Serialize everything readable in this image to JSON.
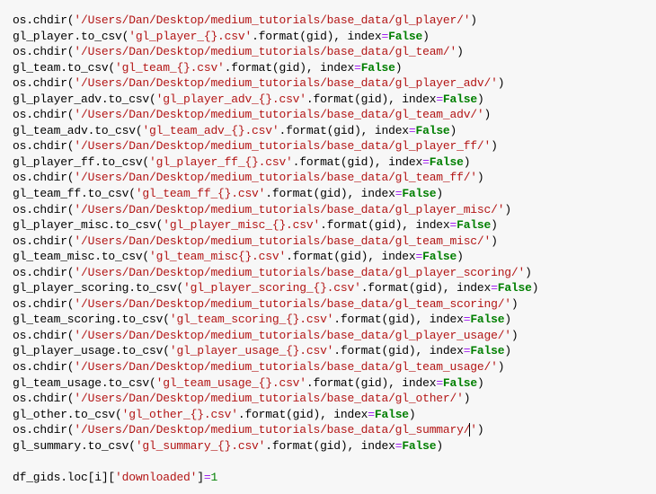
{
  "code_lines": [
    [
      {
        "t": "os.chdir(",
        "cls": "c"
      },
      {
        "t": "'/Users/Dan/Desktop/medium_tutorials/base_data/gl_player/'",
        "cls": "s"
      },
      {
        "t": ")",
        "cls": "c"
      }
    ],
    [
      {
        "t": "gl_player.to_csv(",
        "cls": "c"
      },
      {
        "t": "'gl_player_{}.csv'",
        "cls": "s"
      },
      {
        "t": ".format(gid), index",
        "cls": "c"
      },
      {
        "t": "=",
        "cls": "op"
      },
      {
        "t": "False",
        "cls": "k"
      },
      {
        "t": ")",
        "cls": "c"
      }
    ],
    [
      {
        "t": "os.chdir(",
        "cls": "c"
      },
      {
        "t": "'/Users/Dan/Desktop/medium_tutorials/base_data/gl_team/'",
        "cls": "s"
      },
      {
        "t": ")",
        "cls": "c"
      }
    ],
    [
      {
        "t": "gl_team.to_csv(",
        "cls": "c"
      },
      {
        "t": "'gl_team_{}.csv'",
        "cls": "s"
      },
      {
        "t": ".format(gid), index",
        "cls": "c"
      },
      {
        "t": "=",
        "cls": "op"
      },
      {
        "t": "False",
        "cls": "k"
      },
      {
        "t": ")",
        "cls": "c"
      }
    ],
    [
      {
        "t": "os.chdir(",
        "cls": "c"
      },
      {
        "t": "'/Users/Dan/Desktop/medium_tutorials/base_data/gl_player_adv/'",
        "cls": "s"
      },
      {
        "t": ")",
        "cls": "c"
      }
    ],
    [
      {
        "t": "gl_player_adv.to_csv(",
        "cls": "c"
      },
      {
        "t": "'gl_player_adv_{}.csv'",
        "cls": "s"
      },
      {
        "t": ".format(gid), index",
        "cls": "c"
      },
      {
        "t": "=",
        "cls": "op"
      },
      {
        "t": "False",
        "cls": "k"
      },
      {
        "t": ")",
        "cls": "c"
      }
    ],
    [
      {
        "t": "os.chdir(",
        "cls": "c"
      },
      {
        "t": "'/Users/Dan/Desktop/medium_tutorials/base_data/gl_team_adv/'",
        "cls": "s"
      },
      {
        "t": ")",
        "cls": "c"
      }
    ],
    [
      {
        "t": "gl_team_adv.to_csv(",
        "cls": "c"
      },
      {
        "t": "'gl_team_adv_{}.csv'",
        "cls": "s"
      },
      {
        "t": ".format(gid), index",
        "cls": "c"
      },
      {
        "t": "=",
        "cls": "op"
      },
      {
        "t": "False",
        "cls": "k"
      },
      {
        "t": ")",
        "cls": "c"
      }
    ],
    [
      {
        "t": "os.chdir(",
        "cls": "c"
      },
      {
        "t": "'/Users/Dan/Desktop/medium_tutorials/base_data/gl_player_ff/'",
        "cls": "s"
      },
      {
        "t": ")",
        "cls": "c"
      }
    ],
    [
      {
        "t": "gl_player_ff.to_csv(",
        "cls": "c"
      },
      {
        "t": "'gl_player_ff_{}.csv'",
        "cls": "s"
      },
      {
        "t": ".format(gid), index",
        "cls": "c"
      },
      {
        "t": "=",
        "cls": "op"
      },
      {
        "t": "False",
        "cls": "k"
      },
      {
        "t": ")",
        "cls": "c"
      }
    ],
    [
      {
        "t": "os.chdir(",
        "cls": "c"
      },
      {
        "t": "'/Users/Dan/Desktop/medium_tutorials/base_data/gl_team_ff/'",
        "cls": "s"
      },
      {
        "t": ")",
        "cls": "c"
      }
    ],
    [
      {
        "t": "gl_team_ff.to_csv(",
        "cls": "c"
      },
      {
        "t": "'gl_team_ff_{}.csv'",
        "cls": "s"
      },
      {
        "t": ".format(gid), index",
        "cls": "c"
      },
      {
        "t": "=",
        "cls": "op"
      },
      {
        "t": "False",
        "cls": "k"
      },
      {
        "t": ")",
        "cls": "c"
      }
    ],
    [
      {
        "t": "os.chdir(",
        "cls": "c"
      },
      {
        "t": "'/Users/Dan/Desktop/medium_tutorials/base_data/gl_player_misc/'",
        "cls": "s"
      },
      {
        "t": ")",
        "cls": "c"
      }
    ],
    [
      {
        "t": "gl_player_misc.to_csv(",
        "cls": "c"
      },
      {
        "t": "'gl_player_misc_{}.csv'",
        "cls": "s"
      },
      {
        "t": ".format(gid), index",
        "cls": "c"
      },
      {
        "t": "=",
        "cls": "op"
      },
      {
        "t": "False",
        "cls": "k"
      },
      {
        "t": ")",
        "cls": "c"
      }
    ],
    [
      {
        "t": "os.chdir(",
        "cls": "c"
      },
      {
        "t": "'/Users/Dan/Desktop/medium_tutorials/base_data/gl_team_misc/'",
        "cls": "s"
      },
      {
        "t": ")",
        "cls": "c"
      }
    ],
    [
      {
        "t": "gl_team_misc.to_csv(",
        "cls": "c"
      },
      {
        "t": "'gl_team_misc{}.csv'",
        "cls": "s"
      },
      {
        "t": ".format(gid), index",
        "cls": "c"
      },
      {
        "t": "=",
        "cls": "op"
      },
      {
        "t": "False",
        "cls": "k"
      },
      {
        "t": ")",
        "cls": "c"
      }
    ],
    [
      {
        "t": "os.chdir(",
        "cls": "c"
      },
      {
        "t": "'/Users/Dan/Desktop/medium_tutorials/base_data/gl_player_scoring/'",
        "cls": "s"
      },
      {
        "t": ")",
        "cls": "c"
      }
    ],
    [
      {
        "t": "gl_player_scoring.to_csv(",
        "cls": "c"
      },
      {
        "t": "'gl_player_scoring_{}.csv'",
        "cls": "s"
      },
      {
        "t": ".format(gid), index",
        "cls": "c"
      },
      {
        "t": "=",
        "cls": "op"
      },
      {
        "t": "False",
        "cls": "k"
      },
      {
        "t": ")",
        "cls": "c"
      }
    ],
    [
      {
        "t": "os.chdir(",
        "cls": "c"
      },
      {
        "t": "'/Users/Dan/Desktop/medium_tutorials/base_data/gl_team_scoring/'",
        "cls": "s"
      },
      {
        "t": ")",
        "cls": "c"
      }
    ],
    [
      {
        "t": "gl_team_scoring.to_csv(",
        "cls": "c"
      },
      {
        "t": "'gl_team_scoring_{}.csv'",
        "cls": "s"
      },
      {
        "t": ".format(gid), index",
        "cls": "c"
      },
      {
        "t": "=",
        "cls": "op"
      },
      {
        "t": "False",
        "cls": "k"
      },
      {
        "t": ")",
        "cls": "c"
      }
    ],
    [
      {
        "t": "os.chdir(",
        "cls": "c"
      },
      {
        "t": "'/Users/Dan/Desktop/medium_tutorials/base_data/gl_player_usage/'",
        "cls": "s"
      },
      {
        "t": ")",
        "cls": "c"
      }
    ],
    [
      {
        "t": "gl_player_usage.to_csv(",
        "cls": "c"
      },
      {
        "t": "'gl_player_usage_{}.csv'",
        "cls": "s"
      },
      {
        "t": ".format(gid), index",
        "cls": "c"
      },
      {
        "t": "=",
        "cls": "op"
      },
      {
        "t": "False",
        "cls": "k"
      },
      {
        "t": ")",
        "cls": "c"
      }
    ],
    [
      {
        "t": "os.chdir(",
        "cls": "c"
      },
      {
        "t": "'/Users/Dan/Desktop/medium_tutorials/base_data/gl_team_usage/'",
        "cls": "s"
      },
      {
        "t": ")",
        "cls": "c"
      }
    ],
    [
      {
        "t": "gl_team_usage.to_csv(",
        "cls": "c"
      },
      {
        "t": "'gl_team_usage_{}.csv'",
        "cls": "s"
      },
      {
        "t": ".format(gid), index",
        "cls": "c"
      },
      {
        "t": "=",
        "cls": "op"
      },
      {
        "t": "False",
        "cls": "k"
      },
      {
        "t": ")",
        "cls": "c"
      }
    ],
    [
      {
        "t": "os.chdir(",
        "cls": "c"
      },
      {
        "t": "'/Users/Dan/Desktop/medium_tutorials/base_data/gl_other/'",
        "cls": "s"
      },
      {
        "t": ")",
        "cls": "c"
      }
    ],
    [
      {
        "t": "gl_other.to_csv(",
        "cls": "c"
      },
      {
        "t": "'gl_other_{}.csv'",
        "cls": "s"
      },
      {
        "t": ".format(gid), index",
        "cls": "c"
      },
      {
        "t": "=",
        "cls": "op"
      },
      {
        "t": "False",
        "cls": "k"
      },
      {
        "t": ")",
        "cls": "c"
      }
    ],
    [
      {
        "t": "os.chdir(",
        "cls": "c"
      },
      {
        "t": "'/Users/Dan/Desktop/medium_tutorials/base_data/gl_summary/",
        "cls": "s"
      },
      {
        "t": "",
        "cls": "cursor"
      },
      {
        "t": "'",
        "cls": "s"
      },
      {
        "t": ")",
        "cls": "c"
      }
    ],
    [
      {
        "t": "gl_summary.to_csv(",
        "cls": "c"
      },
      {
        "t": "'gl_summary_{}.csv'",
        "cls": "s"
      },
      {
        "t": ".format(gid), index",
        "cls": "c"
      },
      {
        "t": "=",
        "cls": "op"
      },
      {
        "t": "False",
        "cls": "k"
      },
      {
        "t": ")",
        "cls": "c"
      }
    ],
    [
      {
        "t": "",
        "cls": "c"
      }
    ],
    [
      {
        "t": "df_gids.loc[i][",
        "cls": "c"
      },
      {
        "t": "'downloaded'",
        "cls": "s"
      },
      {
        "t": "]",
        "cls": "c"
      },
      {
        "t": "=",
        "cls": "op"
      },
      {
        "t": "1",
        "cls": "n"
      }
    ]
  ]
}
